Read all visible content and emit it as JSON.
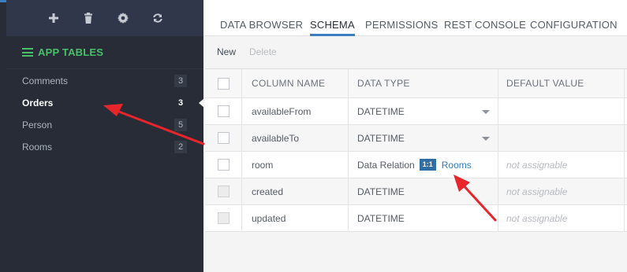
{
  "sidebar": {
    "toolbar": {
      "add_icon": "plus-icon",
      "delete_icon": "trash-icon",
      "settings_icon": "gear-icon",
      "refresh_icon": "refresh-icon"
    },
    "section_title": "APP TABLES",
    "section_icon": "table-list-icon",
    "items": [
      {
        "label": "Comments",
        "count": "3"
      },
      {
        "label": "Orders",
        "count": "3",
        "active": true
      },
      {
        "label": "Person",
        "count": "5"
      },
      {
        "label": "Rooms",
        "count": "2"
      }
    ]
  },
  "tabs": [
    {
      "label": "DATA BROWSER"
    },
    {
      "label": "SCHEMA",
      "active": true
    },
    {
      "label": "PERMISSIONS"
    },
    {
      "label": "REST CONSOLE"
    },
    {
      "label": "CONFIGURATION"
    }
  ],
  "actions": {
    "new_label": "New",
    "delete_label": "Delete"
  },
  "grid": {
    "headers": [
      "COLUMN NAME",
      "DATA TYPE",
      "DEFAULT VALUE"
    ],
    "rows": [
      {
        "name": "availableFrom",
        "type": "DATETIME",
        "default": ""
      },
      {
        "name": "availableTo",
        "type": "DATETIME",
        "default": ""
      },
      {
        "name": "room",
        "type": "Data Relation",
        "relation": "1:1",
        "relation_target": "Rooms",
        "default": "not assignable"
      },
      {
        "name": "created",
        "type": "DATETIME",
        "default": "not assignable"
      },
      {
        "name": "updated",
        "type": "DATETIME",
        "default": "not assignable"
      }
    ]
  },
  "colors": {
    "accent_green": "#48c06a",
    "accent_blue": "#3a7fc1",
    "annotation_red": "#e8252b"
  }
}
